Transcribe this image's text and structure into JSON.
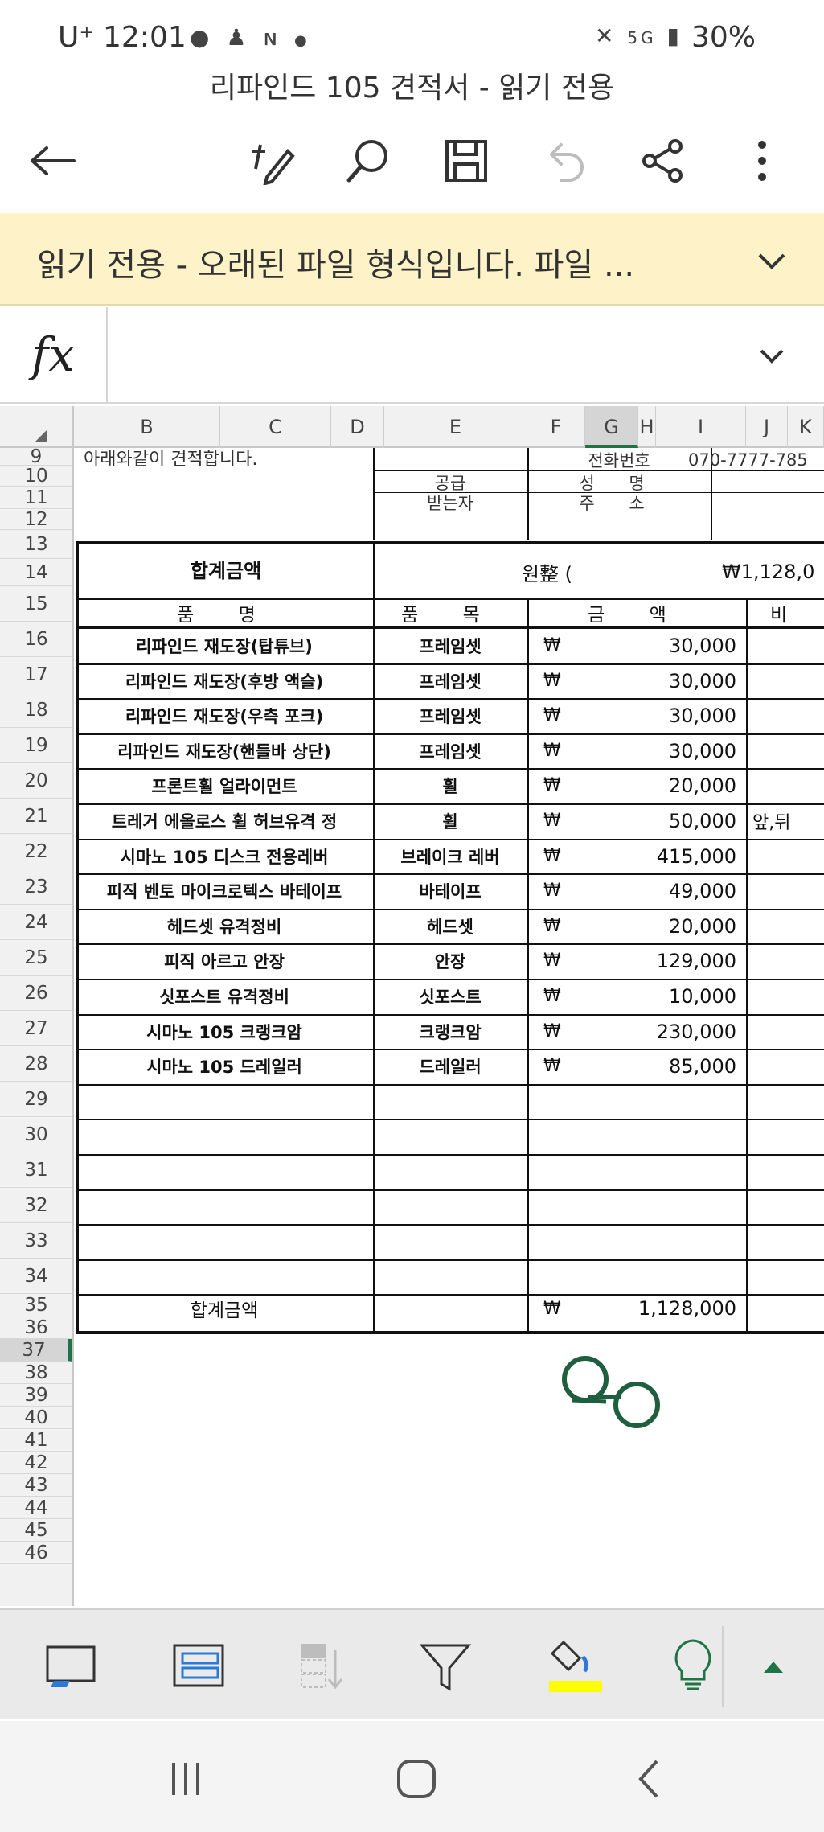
{
  "status_bar": {
    "carrier": "U⁺",
    "time": "12:01",
    "left_icons": [
      "talk-icon",
      "person-icon",
      "n-icon",
      "dot-icon"
    ],
    "right_icons": [
      "mute-icon",
      "5g-icon",
      "signal-icon"
    ],
    "battery": "30%"
  },
  "document": {
    "title": "리파인드 105 견적서 - 읽기 전용"
  },
  "toolbar": {
    "icons": [
      "back-arrow-icon",
      "pen-edit-icon",
      "search-icon",
      "save-icon",
      "undo-icon",
      "share-icon",
      "more-icon"
    ]
  },
  "banner": {
    "text": "읽기 전용 - 오래된 파일 형식입니다. 파일 ..."
  },
  "formula_bar": {
    "fx_label": "fx",
    "value": ""
  },
  "columns": [
    "B",
    "C",
    "D",
    "E",
    "F",
    "G",
    "H",
    "I",
    "J",
    "K"
  ],
  "selected_column": "G",
  "rows": [
    "9",
    "10",
    "11",
    "12",
    "13",
    "14",
    "15",
    "16",
    "17",
    "18",
    "19",
    "20",
    "21",
    "22",
    "23",
    "24",
    "25",
    "26",
    "27",
    "28",
    "29",
    "30",
    "31",
    "32",
    "33",
    "34",
    "35",
    "36",
    "37",
    "38",
    "39",
    "40",
    "41",
    "42",
    "43",
    "44",
    "45",
    "46"
  ],
  "selected_row": "37",
  "sheet": {
    "intro_text": "아래와같이 견적합니다.",
    "phone_label": "전화번호",
    "phone_value": "070-7777-785",
    "supply_label": "공급",
    "name_label": "성 명",
    "receiver_label": "받는자",
    "address_label": "주 소",
    "total_label": "합계금액",
    "total_prefix": "원整 (",
    "total_amount_text": "₩1,128,0",
    "header_item": "품 명",
    "header_category": "품 목",
    "header_amount": "금 액",
    "header_note": "비",
    "currency": "₩",
    "items": [
      {
        "name": "리파인드 재도장(탑튜브)",
        "category": "프레임셋",
        "amount": "30,000",
        "note": ""
      },
      {
        "name": "리파인드 재도장(후방 액슬)",
        "category": "프레임셋",
        "amount": "30,000",
        "note": ""
      },
      {
        "name": "리파인드 재도장(우측 포크)",
        "category": "프레임셋",
        "amount": "30,000",
        "note": ""
      },
      {
        "name": "리파인드 재도장(핸들바 상단)",
        "category": "프레임셋",
        "amount": "30,000",
        "note": ""
      },
      {
        "name": "프론트휠 얼라이먼트",
        "category": "휠",
        "amount": "20,000",
        "note": ""
      },
      {
        "name": "트레거 에올로스 휠 허브유격 정",
        "category": "휠",
        "amount": "50,000",
        "note": "앞,뒤"
      },
      {
        "name": "시마노 105 디스크 전용레버",
        "category": "브레이크 레버",
        "amount": "415,000",
        "note": ""
      },
      {
        "name": "피직 벤토 마이크로텍스 바테이프",
        "category": "바테이프",
        "amount": "49,000",
        "note": ""
      },
      {
        "name": "헤드셋 유격정비",
        "category": "헤드셋",
        "amount": "20,000",
        "note": ""
      },
      {
        "name": "피직 아르고 안장",
        "category": "안장",
        "amount": "129,000",
        "note": ""
      },
      {
        "name": "싯포스트 유격정비",
        "category": "싯포스트",
        "amount": "10,000",
        "note": ""
      },
      {
        "name": "시마노 105 크랭크암",
        "category": "크랭크암",
        "amount": "230,000",
        "note": ""
      },
      {
        "name": "시마노 105 드레일러",
        "category": "드레일러",
        "amount": "85,000",
        "note": ""
      }
    ],
    "sum_label": "합계금액",
    "sum_amount": "1,128,000"
  },
  "app_bar": {
    "icons": [
      "cell-format-icon",
      "table-icon",
      "insert-rows-icon",
      "filter-icon",
      "fill-color-icon",
      "lightbulb-icon",
      "expand-up-icon"
    ],
    "fill_color": "#ffff00",
    "accent": "#217346"
  },
  "nav_bar": {
    "icons": [
      "recents-icon",
      "home-icon",
      "back-icon"
    ]
  }
}
